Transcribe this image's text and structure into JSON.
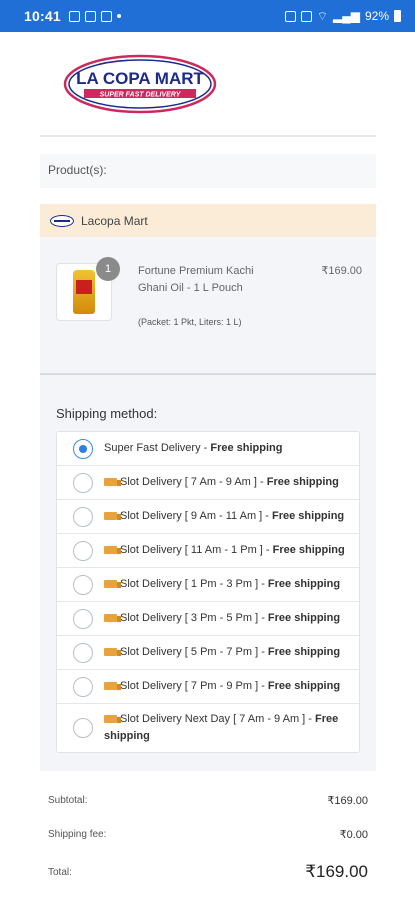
{
  "status_bar": {
    "time": "10:41",
    "battery": "92%"
  },
  "logo": {
    "name": "LA COPA MART",
    "tagline": "SUPER FAST DELIVERY"
  },
  "products_label": "Product(s):",
  "vendor": {
    "name": "Lacopa Mart"
  },
  "product": {
    "name": "Fortune Premium Kachi Ghani Oil - 1 L Pouch",
    "meta": "(Packet: 1 Pkt, Liters: 1 L)",
    "price": "₹169.00",
    "quantity": "1"
  },
  "shipping": {
    "title": "Shipping method:",
    "selected_index": 0,
    "options": [
      {
        "label": "Super Fast Delivery - ",
        "bold": "Free shipping",
        "icon": "none"
      },
      {
        "label": "Slot Delivery [ 7 Am - 9 Am ] - ",
        "bold": "Free shipping",
        "icon": "truck-icon"
      },
      {
        "label": "Slot Delivery [ 9 Am - 11 Am ] - ",
        "bold": "Free shipping",
        "icon": "truck-icon"
      },
      {
        "label": "Slot Delivery [ 11 Am - 1 Pm ] - ",
        "bold": "Free shipping",
        "icon": "truck-icon"
      },
      {
        "label": "Slot Delivery [ 1 Pm - 3 Pm ] - ",
        "bold": "Free shipping",
        "icon": "truck-icon"
      },
      {
        "label": "Slot Delivery [ 3 Pm - 5 Pm ] - ",
        "bold": "Free shipping",
        "icon": "truck-icon"
      },
      {
        "label": "Slot Delivery [ 5 Pm - 7 Pm ] - ",
        "bold": "Free shipping",
        "icon": "truck-icon"
      },
      {
        "label": "Slot Delivery [ 7 Pm - 9 Pm ] - ",
        "bold": "Free shipping",
        "icon": "truck-icon"
      },
      {
        "label": "Slot Delivery Next Day [ 7 Am - 9 Am ] - ",
        "bold": "Free shipping",
        "icon": "truck-icon"
      }
    ]
  },
  "summary": {
    "subtotal_label": "Subtotal:",
    "subtotal_value": "₹169.00",
    "shipping_label": "Shipping fee:",
    "shipping_value": "₹0.00",
    "total_label": "Total:",
    "total_value": "₹169.00"
  }
}
